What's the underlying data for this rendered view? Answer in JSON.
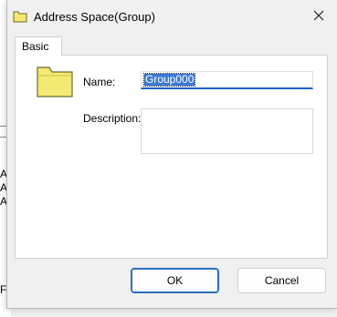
{
  "background": {
    "text_lines": [
      "Ar",
      "Ar",
      "Ar",
      "F C"
    ]
  },
  "dialog": {
    "title": "Address Space(Group)",
    "close_icon": "close-icon",
    "tabs": [
      {
        "label": "Basic",
        "active": true
      }
    ],
    "fields": {
      "name_label": "Name:",
      "name_value": "Group000",
      "description_label": "Description:",
      "description_value": ""
    },
    "buttons": {
      "ok_label": "OK",
      "cancel_label": "Cancel"
    }
  },
  "colors": {
    "folder": "#f2ea73",
    "accent": "#1a62c0",
    "selection": "#3a78d6"
  }
}
